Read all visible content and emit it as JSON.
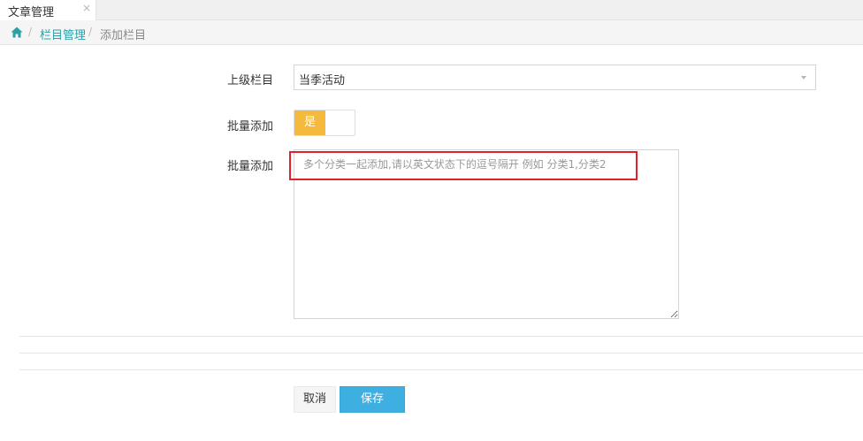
{
  "tabs": [
    {
      "label": "文章管理",
      "close_icon": "×"
    }
  ],
  "breadcrumb": {
    "home_icon": "home-icon",
    "separator": "/",
    "items": [
      "栏目管理",
      "添加栏目"
    ]
  },
  "form": {
    "parent_label": "上级栏目",
    "parent_value": "当季活动",
    "batch_toggle_label": "批量添加",
    "batch_toggle_value": "是",
    "batch_text_label": "批量添加",
    "batch_text_placeholder": "多个分类一起添加,请以英文状态下的逗号隔开 例如 分类1,分类2",
    "batch_text_value": ""
  },
  "actions": {
    "cancel_label": "取消",
    "save_label": "保存"
  },
  "colors": {
    "accent": "#2aa0a6",
    "toggle_on": "#f5b93d",
    "save_button": "#3dafe0",
    "highlight_box": "#e0202c"
  }
}
